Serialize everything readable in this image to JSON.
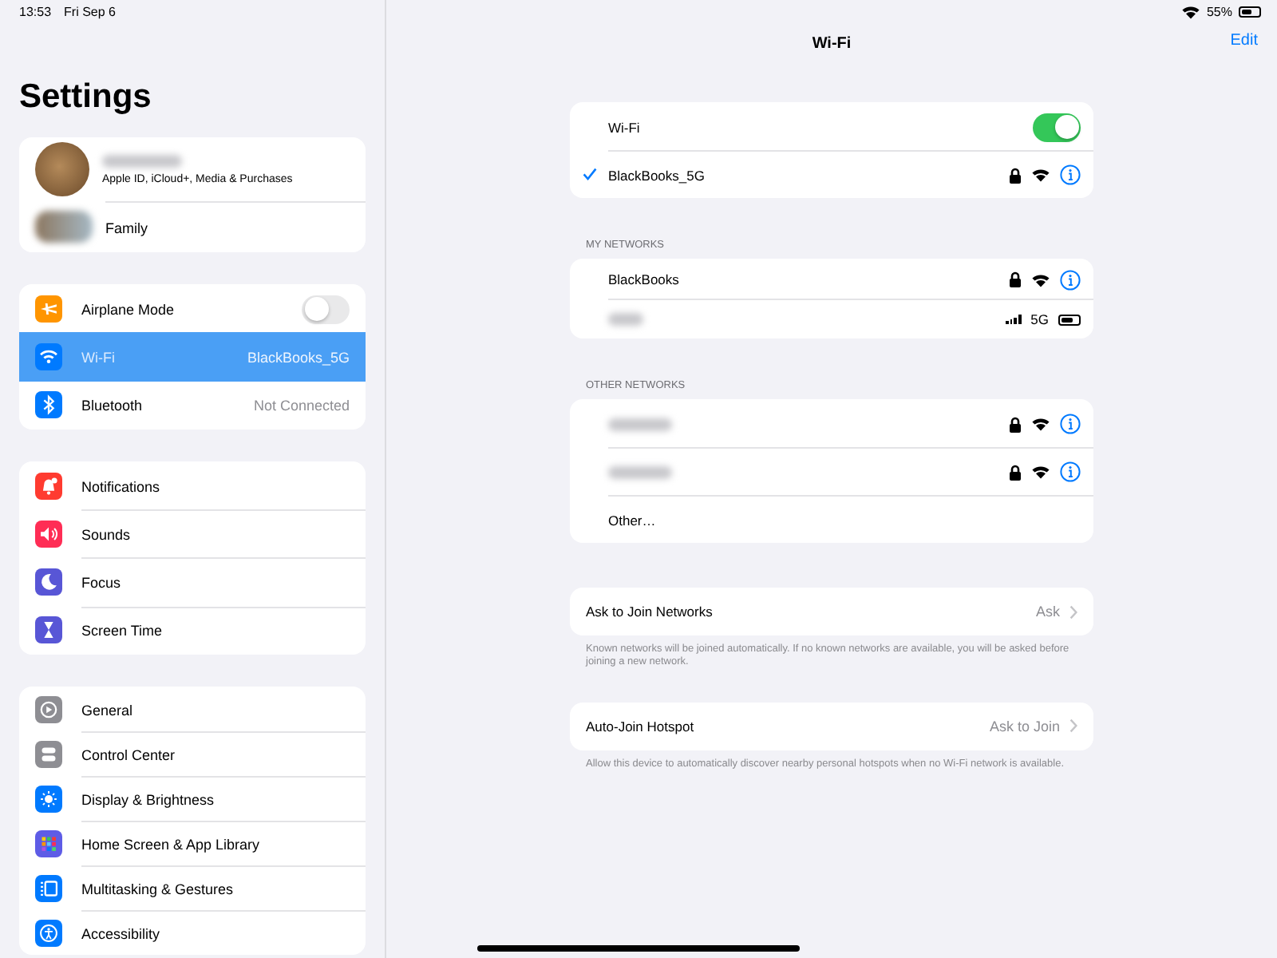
{
  "status_bar": {
    "time": "13:53",
    "date": "Fri Sep 6",
    "battery": "55%"
  },
  "sidebar": {
    "title": "Settings",
    "profile": {
      "subtitle": "Apple ID, iCloud+, Media & Purchases",
      "family": "Family"
    },
    "groups": [
      {
        "items": [
          {
            "label": "Airplane Mode",
            "kind": "toggle",
            "on": false,
            "selected": false,
            "color": "#ff9500"
          },
          {
            "label": "Wi-Fi",
            "kind": "link",
            "value": "BlackBooks_5G",
            "selected": true,
            "color": "#007aff"
          },
          {
            "label": "Bluetooth",
            "kind": "link",
            "value": "Not Connected",
            "selected": false,
            "color": "#007aff"
          }
        ]
      },
      {
        "items": [
          {
            "label": "Notifications",
            "kind": "link",
            "selected": false,
            "color": "#ff3b30"
          },
          {
            "label": "Sounds",
            "kind": "link",
            "selected": false,
            "color": "#ff2d55"
          },
          {
            "label": "Focus",
            "kind": "link",
            "selected": false,
            "color": "#5856d6"
          },
          {
            "label": "Screen Time",
            "kind": "link",
            "selected": false,
            "color": "#5856d6"
          }
        ]
      },
      {
        "items": [
          {
            "label": "General",
            "kind": "link",
            "selected": false,
            "color": "#8e8e93"
          },
          {
            "label": "Control Center",
            "kind": "link",
            "selected": false,
            "color": "#8e8e93"
          },
          {
            "label": "Display & Brightness",
            "kind": "link",
            "selected": false,
            "color": "#007aff"
          },
          {
            "label": "Home Screen & App Library",
            "kind": "link",
            "selected": false,
            "color": "#5e5ce6"
          },
          {
            "label": "Multitasking & Gestures",
            "kind": "link",
            "selected": false,
            "color": "#007aff"
          },
          {
            "label": "Accessibility",
            "kind": "link",
            "selected": false,
            "color": "#007aff"
          }
        ]
      }
    ]
  },
  "detail": {
    "title": "Wi-Fi",
    "edit": "Edit",
    "wifi": {
      "label": "Wi-Fi",
      "on": true,
      "network": {
        "name": "BlackBooks_5G",
        "checked": true
      }
    },
    "my_networks": {
      "header": "MY NETWORKS",
      "rows": [
        {
          "kind": "wifi",
          "name": "BlackBooks"
        },
        {
          "kind": "hotspot",
          "signal": "5G"
        }
      ]
    },
    "other_networks": {
      "header": "OTHER NETWORKS",
      "rows": [
        {
          "kind": "wifi"
        },
        {
          "kind": "wifi"
        },
        {
          "kind": "other",
          "name": "Other…"
        }
      ]
    },
    "options": [
      {
        "label": "Ask to Join Networks",
        "value": "Ask",
        "footer": "Known networks will be joined automatically. If no known networks are available, you will be asked before joining a new network."
      },
      {
        "label": "Auto-Join Hotspot",
        "value": "Ask to Join",
        "footer": "Allow this device to automatically discover nearby personal hotspots when no Wi-Fi network is available."
      }
    ]
  }
}
